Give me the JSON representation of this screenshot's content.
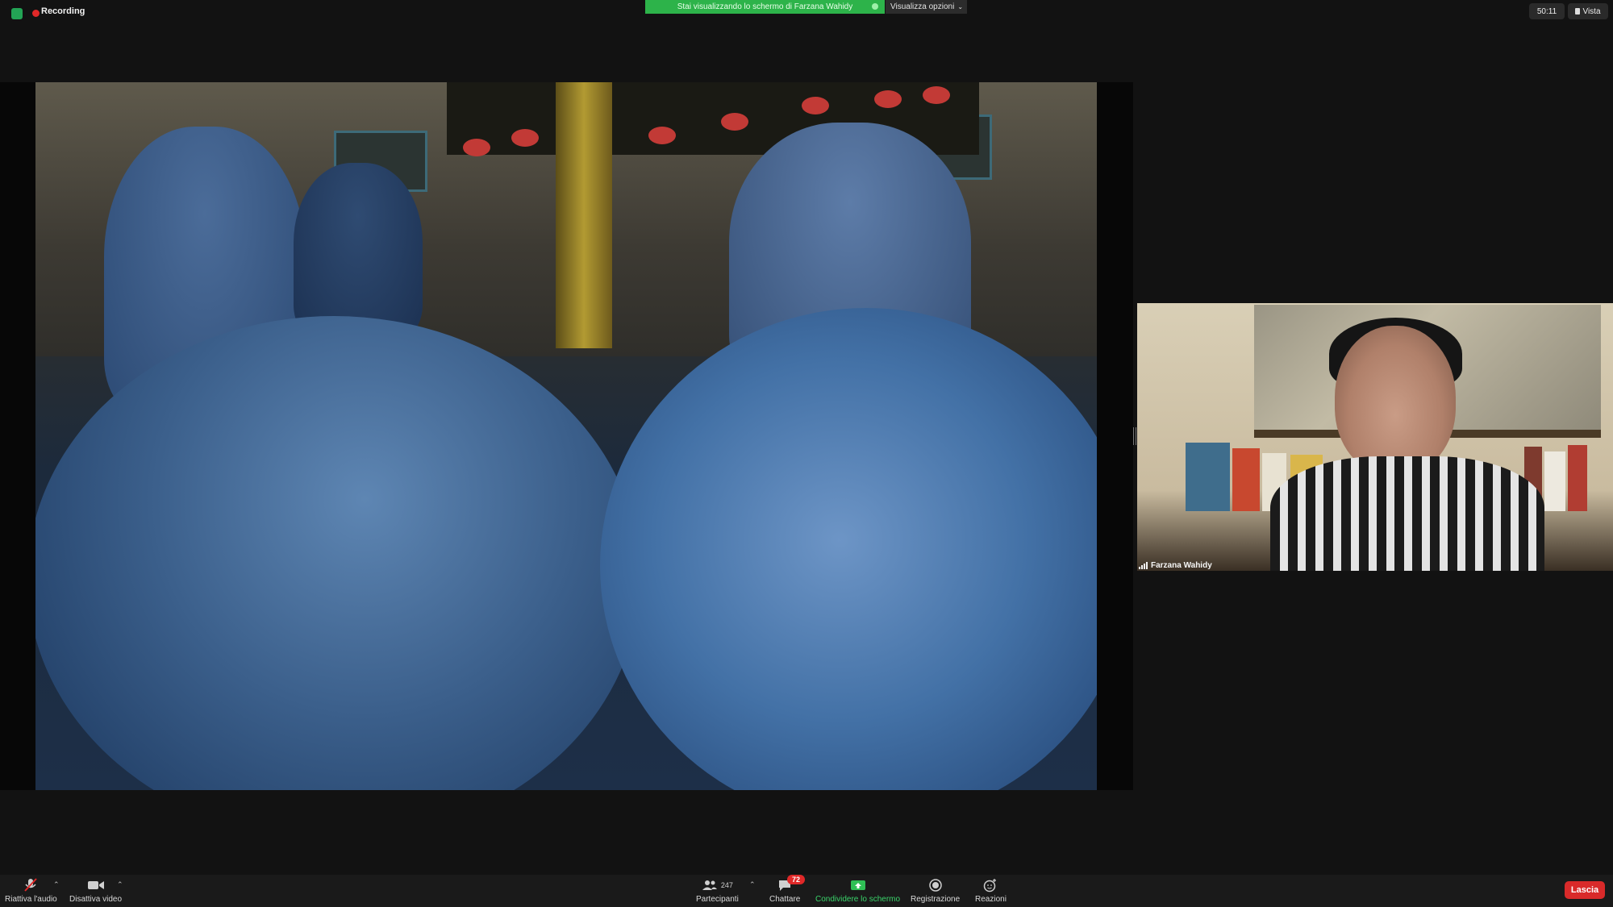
{
  "top": {
    "recording_label": "Recording",
    "share_banner": "Stai visualizzando lo schermo di Farzana Wahidy",
    "view_options": "Visualizza opzioni",
    "timer": "50:11",
    "view_label": "Vista"
  },
  "speaker": {
    "name": "Farzana Wahidy"
  },
  "toolbar": {
    "audio_label": "Riattiva l'audio",
    "video_label": "Disattiva video",
    "participants_label": "Partecipanti",
    "participants_count": "247",
    "chat_label": "Chattare",
    "chat_badge": "72",
    "share_label": "Condividere lo schermo",
    "record_label": "Registrazione",
    "reactions_label": "Reazioni",
    "leave_label": "Lascia"
  },
  "colors": {
    "share_green": "#2db34a",
    "leave_red": "#d92a2a",
    "recording_red": "#e02828"
  }
}
